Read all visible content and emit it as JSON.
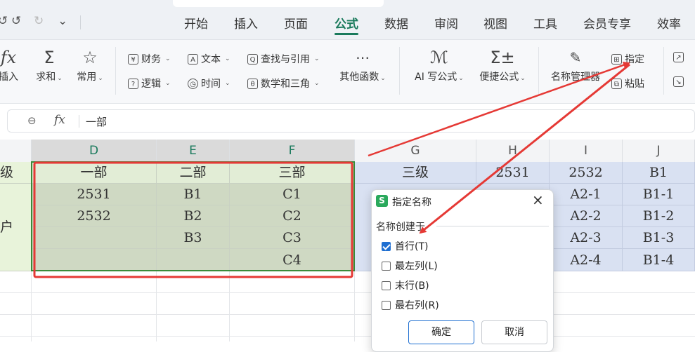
{
  "menubar": {
    "tabs": [
      "开始",
      "插入",
      "页面",
      "公式",
      "数据",
      "审阅",
      "视图",
      "工具",
      "会员专享",
      "效率"
    ],
    "active_tab": "公式",
    "quick_access": {
      "undo": "↺",
      "redo": "↻",
      "more": "⌄"
    }
  },
  "ribbon": {
    "insert_function": "插入",
    "autosum": "求和",
    "common": "常用",
    "finance": "财务",
    "logic": "逻辑",
    "text": "文本",
    "time": "时间",
    "lookup": "查找与引用",
    "math": "数学和三角",
    "other_functions": "其他函数",
    "ai_formula": "AI 写公式",
    "quick_formula": "便捷公式",
    "name_manager": "名称管理器",
    "define": "指定",
    "paste": "粘贴"
  },
  "formula_bar": {
    "fx": "fx",
    "value": "一部"
  },
  "sheet": {
    "column_headers": [
      "D",
      "E",
      "F",
      "G",
      "H",
      "I",
      "J"
    ],
    "row_label_1": "级",
    "row_label_2": "户",
    "selection": {
      "rows": [
        [
          "一部",
          "二部",
          "三部"
        ],
        [
          "2531",
          "B1",
          "C1"
        ],
        [
          "2532",
          "B2",
          "C2"
        ],
        [
          "",
          "B3",
          "C3"
        ],
        [
          "",
          "",
          "C4"
        ]
      ]
    },
    "right_table": {
      "header": [
        "三级",
        "2531",
        "2532",
        "B1"
      ],
      "rows": [
        [
          "A2-1",
          "B1-1"
        ],
        [
          "A2-2",
          "B1-2"
        ],
        [
          "A2-3",
          "B1-3"
        ],
        [
          "A2-4",
          "B1-4"
        ]
      ]
    }
  },
  "dialog": {
    "logo": "S",
    "title": "指定名称",
    "group_label": "名称创建于",
    "options": [
      {
        "label": "首行(T)",
        "checked": true
      },
      {
        "label": "最左列(L)",
        "checked": false
      },
      {
        "label": "末行(B)",
        "checked": false
      },
      {
        "label": "最右列(R)",
        "checked": false
      }
    ],
    "ok": "确定",
    "cancel": "取消"
  },
  "colors": {
    "accent": "#1a7a5c",
    "annotation": "#e53935",
    "selection_fill": "#cfd9c3",
    "table_fill": "#d9e1f2",
    "header_fill": "#e8f3da"
  }
}
